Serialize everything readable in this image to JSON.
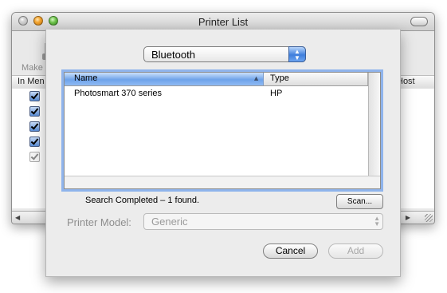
{
  "window": {
    "title": "Printer List",
    "toolbar_make_label": "Make",
    "list_header_left": "In Men",
    "list_header_right": "Host"
  },
  "sheet": {
    "connection_popup": {
      "selected": "Bluetooth"
    },
    "table": {
      "columns": [
        "Name",
        "Type"
      ],
      "sort_indicator": "▲",
      "rows": [
        {
          "name": "Photosmart 370 series",
          "type": "HP"
        }
      ]
    },
    "status_text": "Search Completed – 1 found.",
    "scan_button": "Scan...",
    "printer_model_label": "Printer Model:",
    "printer_model_value": "Generic",
    "cancel_button": "Cancel",
    "add_button": "Add"
  }
}
